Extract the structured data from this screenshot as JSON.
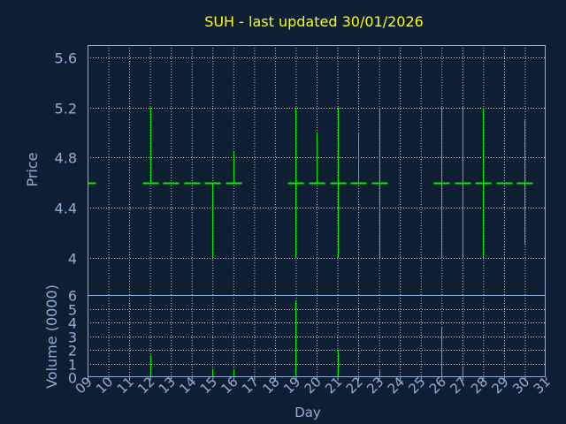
{
  "chart_data": {
    "type": "bar",
    "title": "SUH - last updated 30/01/2026",
    "xlabel": "Day",
    "x_ticks": [
      "09",
      "10",
      "11",
      "12",
      "13",
      "14",
      "15",
      "16",
      "17",
      "18",
      "19",
      "20",
      "21",
      "22",
      "23",
      "24",
      "25",
      "26",
      "27",
      "28",
      "29",
      "30",
      "31"
    ],
    "price": {
      "ylabel": "Price",
      "ylim": [
        3.7,
        5.7
      ],
      "y_ticks": [
        4,
        4.4,
        4.8,
        5.2,
        5.6
      ],
      "y_tick_labels": [
        "4",
        "4.4",
        "4.8",
        "5.2",
        "5.6"
      ],
      "bars": [
        {
          "day": 9,
          "high": 4.6,
          "low": 4.6,
          "close": 4.6
        },
        {
          "day": 12,
          "high": 5.2,
          "low": 4.6,
          "close": 4.6
        },
        {
          "day": 13,
          "high": 4.6,
          "low": 4.6,
          "close": 4.6
        },
        {
          "day": 14,
          "high": 4.6,
          "low": 4.6,
          "close": 4.6
        },
        {
          "day": 15,
          "high": 4.6,
          "low": 4.0,
          "close": 4.6
        },
        {
          "day": 16,
          "high": 4.85,
          "low": 4.6,
          "close": 4.6
        },
        {
          "day": 19,
          "high": 5.2,
          "low": 4.0,
          "close": 4.6
        },
        {
          "day": 20,
          "high": 5.0,
          "low": 4.6,
          "close": 4.6
        },
        {
          "day": 21,
          "high": 5.2,
          "low": 4.0,
          "close": 4.6
        },
        {
          "day": 22,
          "high": 5.0,
          "low": 4.6,
          "close": 4.6
        },
        {
          "day": 23,
          "high": 5.2,
          "low": 4.0,
          "close": 4.6
        },
        {
          "day": 26,
          "high": 5.2,
          "low": 4.0,
          "close": 4.6
        },
        {
          "day": 27,
          "high": 5.2,
          "low": 4.0,
          "close": 4.6
        },
        {
          "day": 28,
          "high": 5.2,
          "low": 4.0,
          "close": 4.6
        },
        {
          "day": 29,
          "high": 4.6,
          "low": 4.6,
          "close": 4.6
        },
        {
          "day": 30,
          "high": 5.1,
          "low": 4.1,
          "close": 4.6
        }
      ]
    },
    "volume": {
      "ylabel": "Volume (0000)",
      "ylim": [
        0,
        6
      ],
      "y_ticks": [
        0,
        1,
        2,
        3,
        4,
        5,
        6
      ],
      "y_tick_labels": [
        "0",
        "1",
        "2",
        "3",
        "4",
        "5",
        "6"
      ],
      "bars": [
        {
          "day": 12,
          "value": 1.6
        },
        {
          "day": 15,
          "value": 0.6
        },
        {
          "day": 16,
          "value": 0.6
        },
        {
          "day": 19,
          "value": 5.6
        },
        {
          "day": 21,
          "value": 2.0
        },
        {
          "day": 23,
          "value": 0.5
        },
        {
          "day": 26,
          "value": 3.6
        },
        {
          "day": 27,
          "value": 0.8
        }
      ]
    },
    "xlim": [
      9,
      31
    ],
    "grid": true,
    "colors": {
      "background": "#0f1f33",
      "title": "#ffff00",
      "axis_text": "#8fb0d4",
      "frame": "#8fb0d4",
      "grid": "#ffffff",
      "bars": "#00ee00"
    }
  }
}
